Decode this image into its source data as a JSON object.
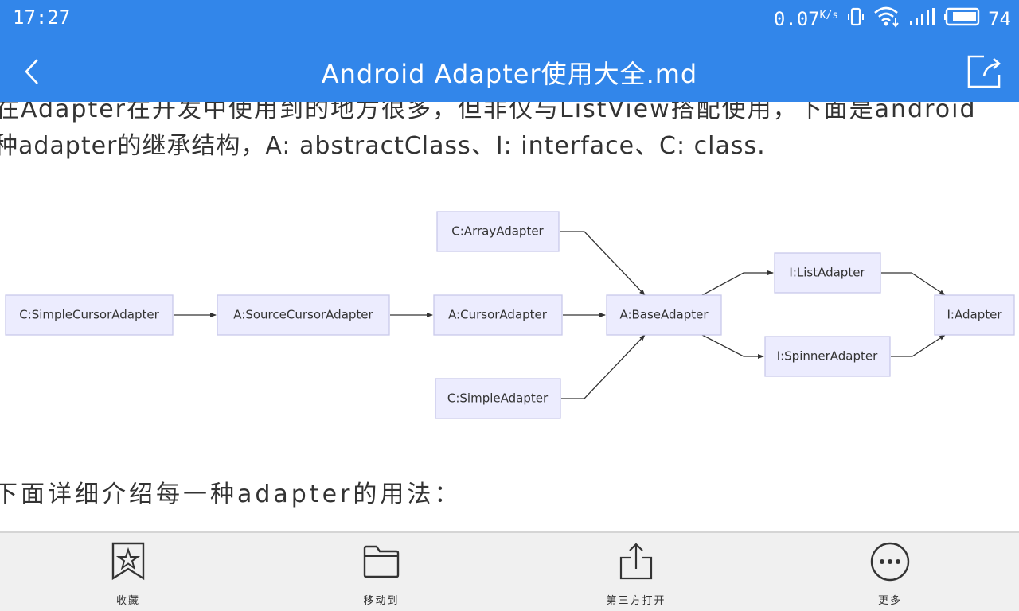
{
  "status_bar": {
    "time": "17:27",
    "network_speed": "0.07",
    "network_speed_unit": "K/s",
    "battery_percent": "74",
    "icons": [
      "vibrate-icon",
      "wifi-icon",
      "signal-icon",
      "battery-icon"
    ]
  },
  "header": {
    "title": "Android Adapter使用大全.md",
    "back_icon": "chevron-left-icon",
    "share_icon": "share-external-icon"
  },
  "document": {
    "clipped_line": "在Adapter在开发中使用到的地方很多，但非仅与ListView搭配使用，下面是android",
    "paragraph_line": "种adapter的继承结构，A: abstractClass、I: interface、C: class.",
    "section_intro": "下面详细介绍每一种adapter的用法："
  },
  "diagram": {
    "nodes": [
      {
        "id": "simple_cursor",
        "label": "C:SimpleCursorAdapter"
      },
      {
        "id": "source_cursor",
        "label": "A:SourceCursorAdapter"
      },
      {
        "id": "cursor",
        "label": "A:CursorAdapter"
      },
      {
        "id": "array",
        "label": "C:ArrayAdapter"
      },
      {
        "id": "simple",
        "label": "C:SimpleAdapter"
      },
      {
        "id": "base",
        "label": "A:BaseAdapter"
      },
      {
        "id": "list",
        "label": "I:ListAdapter"
      },
      {
        "id": "spinner",
        "label": "I:SpinnerAdapter"
      },
      {
        "id": "adapter",
        "label": "I:Adapter"
      }
    ],
    "edges": [
      {
        "from": "simple_cursor",
        "to": "source_cursor"
      },
      {
        "from": "source_cursor",
        "to": "cursor"
      },
      {
        "from": "cursor",
        "to": "base"
      },
      {
        "from": "array",
        "to": "base"
      },
      {
        "from": "simple",
        "to": "base"
      },
      {
        "from": "base",
        "to": "list"
      },
      {
        "from": "base",
        "to": "spinner"
      },
      {
        "from": "list",
        "to": "adapter"
      },
      {
        "from": "spinner",
        "to": "adapter"
      }
    ]
  },
  "bottom_bar": {
    "items": [
      {
        "label": "收藏",
        "icon": "bookmark-star-icon"
      },
      {
        "label": "移动到",
        "icon": "folder-icon"
      },
      {
        "label": "第三方打开",
        "icon": "share-upload-icon"
      },
      {
        "label": "更多",
        "icon": "more-dots-icon"
      }
    ]
  },
  "colors": {
    "appbar": "#3286ea",
    "node_fill": "#ececfe",
    "node_stroke": "#c9c9ea",
    "bottombar": "#f0f0f0"
  }
}
